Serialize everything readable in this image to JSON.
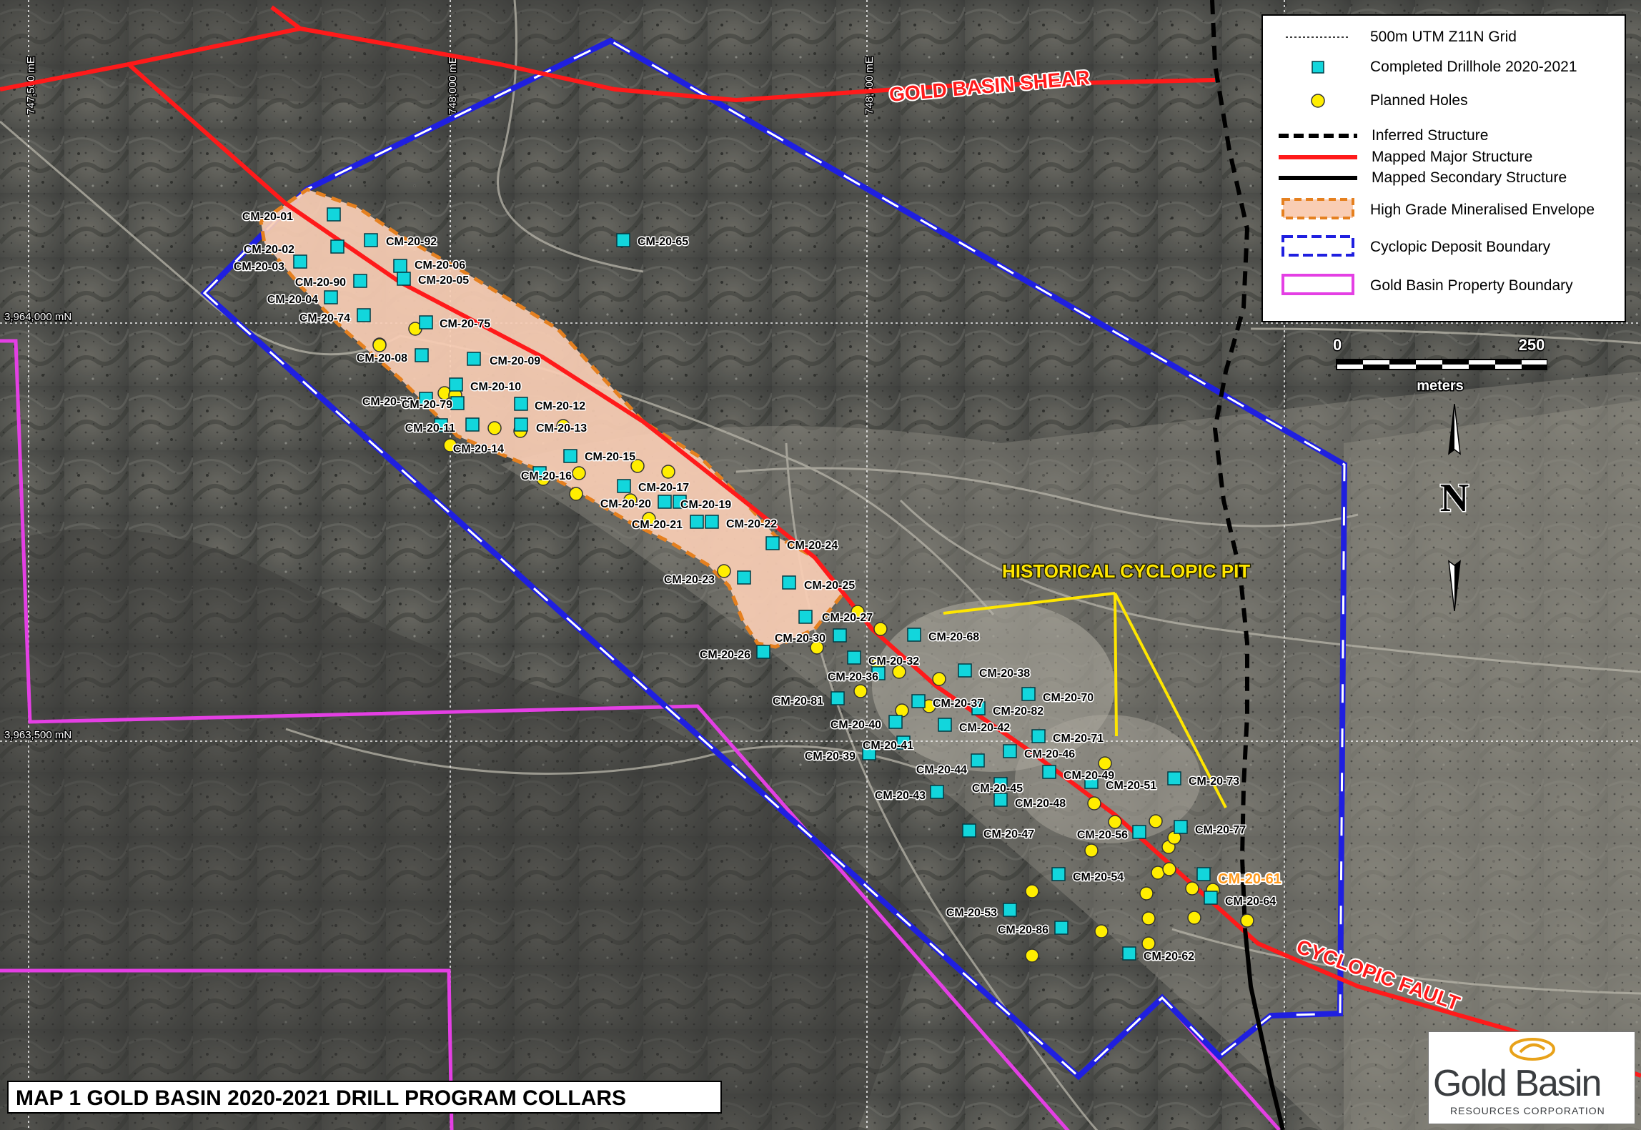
{
  "map": {
    "title": "MAP 1 GOLD BASIN 2020-2021 DRILL PROGRAM COLLARS",
    "grid_labels": {
      "e1": "747,500 mE",
      "e2": "748,000 mE",
      "e3": "748,500 mE",
      "n1": "3,964,000 mN",
      "n2": "3,963,500 mN"
    },
    "features": {
      "shear": "GOLD BASIN SHEAR",
      "fault": "CYCLOPIC FAULT",
      "pit": "HISTORICAL CYCLOPIC PIT"
    },
    "highlighted_hole": "CM-20-61",
    "colors": {
      "drillhole": "#12d6dc",
      "planned": "#ffee00",
      "mapped_major": "#ff1a1a",
      "deposit_boundary": "#1f1fe0",
      "property_boundary": "#e43fe4",
      "envelope_fill": "#f9cdb4",
      "envelope_edge": "#e5801f",
      "highlight": "#ff9a1e"
    }
  },
  "legend": {
    "grid": "500m UTM Z11N Grid",
    "completed": "Completed Drillhole 2020-2021",
    "planned": "Planned Holes",
    "inferred": "Inferred Structure",
    "major": "Mapped Major Structure",
    "secondary": "Mapped Secondary Structure",
    "envelope": "High Grade Mineralised Envelope",
    "deposit": "Cyclopic Deposit Boundary",
    "property": "Gold Basin Property Boundary"
  },
  "scale": {
    "start": "0",
    "end": "250",
    "unit": "meters"
  },
  "north": {
    "label": "N"
  },
  "logo": {
    "name": "Gold Basin",
    "subtitle": "RESOURCES CORPORATION",
    "icon": "gold-basin-logo-icon"
  },
  "holes": [
    {
      "label": "CM-20-01"
    },
    {
      "label": "CM-20-02"
    },
    {
      "label": "CM-20-03"
    },
    {
      "label": "CM-20-92"
    },
    {
      "label": "CM-20-06"
    },
    {
      "label": "CM-20-05"
    },
    {
      "label": "CM-20-90"
    },
    {
      "label": "CM-20-04"
    },
    {
      "label": "CM-20-74"
    },
    {
      "label": "CM-20-75"
    },
    {
      "label": "CM-20-08"
    },
    {
      "label": "CM-20-09"
    },
    {
      "label": "CM-20-10"
    },
    {
      "label": "CM-20-76"
    },
    {
      "label": "CM-20-79"
    },
    {
      "label": "CM-20-12"
    },
    {
      "label": "CM-20-11"
    },
    {
      "label": "CM-20-13"
    },
    {
      "label": "CM-20-14"
    },
    {
      "label": "CM-20-15"
    },
    {
      "label": "CM-20-16"
    },
    {
      "label": "CM-20-17"
    },
    {
      "label": "CM-20-20"
    },
    {
      "label": "CM-20-19"
    },
    {
      "label": "CM-20-21"
    },
    {
      "label": "CM-20-22"
    },
    {
      "label": "CM-20-24"
    },
    {
      "label": "CM-20-23"
    },
    {
      "label": "CM-20-25"
    },
    {
      "label": "CM-20-27"
    },
    {
      "label": "CM-20-30"
    },
    {
      "label": "CM-20-26"
    },
    {
      "label": "CM-20-68"
    },
    {
      "label": "CM-20-32"
    },
    {
      "label": "CM-20-36"
    },
    {
      "label": "CM-20-38"
    },
    {
      "label": "CM-20-81"
    },
    {
      "label": "CM-20-37"
    },
    {
      "label": "CM-20-70"
    },
    {
      "label": "CM-20-82"
    },
    {
      "label": "CM-20-40"
    },
    {
      "label": "CM-20-42"
    },
    {
      "label": "CM-20-41"
    },
    {
      "label": "CM-20-71"
    },
    {
      "label": "CM-20-39"
    },
    {
      "label": "CM-20-46"
    },
    {
      "label": "CM-20-44"
    },
    {
      "label": "CM-20-49"
    },
    {
      "label": "CM-20-45"
    },
    {
      "label": "CM-20-51"
    },
    {
      "label": "CM-20-73"
    },
    {
      "label": "CM-20-43"
    },
    {
      "label": "CM-20-48"
    },
    {
      "label": "CM-20-77"
    },
    {
      "label": "CM-20-47"
    },
    {
      "label": "CM-20-56"
    },
    {
      "label": "CM-20-54"
    },
    {
      "label": "CM-20-64"
    },
    {
      "label": "CM-20-53"
    },
    {
      "label": "CM-20-86"
    },
    {
      "label": "CM-20-62"
    },
    {
      "label": "CM-20-65"
    }
  ]
}
